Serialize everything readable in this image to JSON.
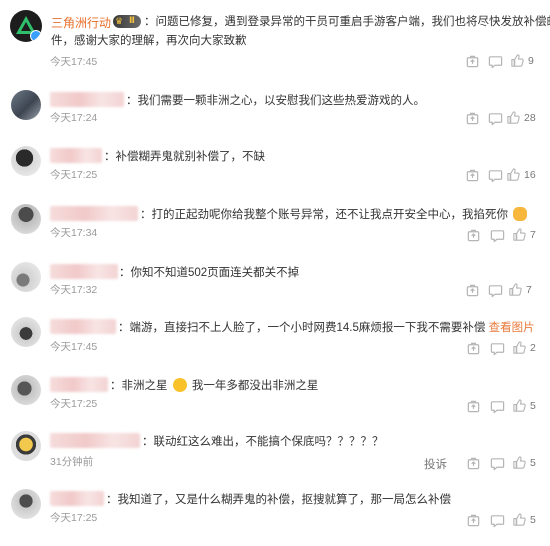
{
  "comments": [
    {
      "name": "三角洲行动",
      "level": "Ⅱ",
      "text_lines": [
        "：问题已修复，遇到登录异常的干员可重启手游客户端，我们也将尽快发放补偿邮件，感谢大家的理解，再次向大家致歉"
      ],
      "line1": "：问题已修复，遇到登录异常的干员可重启手游客户端，我们也将尽快发放补偿邮",
      "line2": "件，感谢大家的理解，再次向大家致歉",
      "time": "今天17:45",
      "likes": "9"
    },
    {
      "text": "：我们需要一颗非洲之心，以安慰我们这些热爱游戏的人。",
      "time": "今天17:24",
      "likes": "28"
    },
    {
      "text": "：补偿糊弄鬼就别补偿了，不缺",
      "time": "今天17:25",
      "likes": "16"
    },
    {
      "text": "：打的正起劲呢你给我整个账号异常，还不让我点开安全中心，我掐死你",
      "time": "今天17:34",
      "likes": "7"
    },
    {
      "text": "：你知不知道502页面连关都关不掉",
      "time": "今天17:32",
      "likes": "7"
    },
    {
      "text": "：端游，直接扫不上人脸了，一个小时网费14.5麻烦报一下我不需要补偿",
      "link": "查看图片",
      "time": "今天17:45",
      "likes": "2"
    },
    {
      "text_a": "：非洲之星",
      "text_b": "我一年多都没出非洲之星",
      "time": "今天17:25",
      "likes": "5"
    },
    {
      "text": "：联动红这么难出，不能搞个保底吗？？？？？",
      "time": "31分钟前",
      "likes": "5",
      "report": "投诉"
    },
    {
      "text": "：我知道了，又是什么糊弄鬼的补偿，抠搜就算了，那一局怎么补偿",
      "time": "今天17:25",
      "likes": "5"
    }
  ],
  "colors": {
    "official_name": "#e86f2b",
    "time": "#9a9a9a",
    "link": "#e87a3c"
  },
  "icons": {
    "share": "share-icon",
    "comment": "comment-icon",
    "like": "thumbs-up-icon"
  }
}
